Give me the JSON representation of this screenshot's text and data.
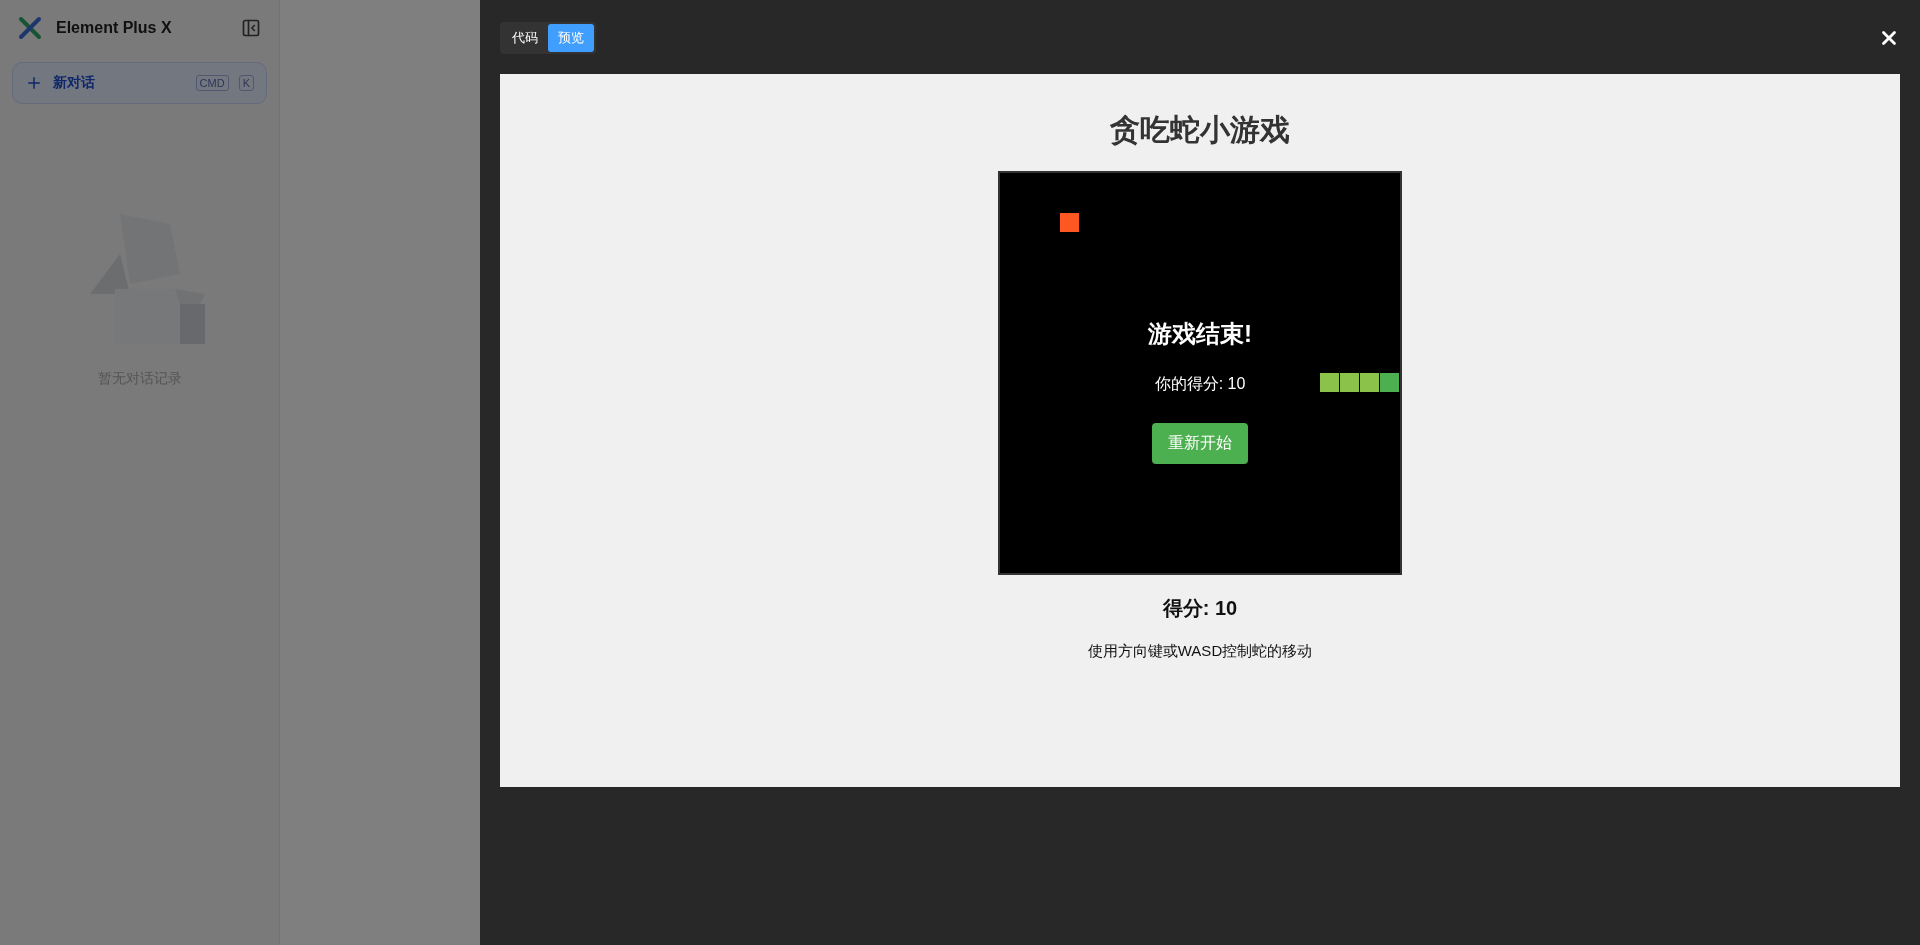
{
  "sidebar": {
    "logo_text": "Element Plus X",
    "new_chat": {
      "label": "新对话",
      "shortcut": [
        "CMD",
        "K"
      ]
    },
    "empty_text": "暂无对话记录"
  },
  "drawer": {
    "tabs": [
      {
        "label": "代码",
        "selected": false
      },
      {
        "label": "预览",
        "selected": true
      }
    ],
    "preview": {
      "title": "贪吃蛇小游戏",
      "game_over": {
        "heading": "游戏结束!",
        "score": "你的得分: 10",
        "button": "重新开始"
      },
      "score": "得分: 10",
      "hint": "使用方向键或WASD控制蛇的移动"
    }
  }
}
